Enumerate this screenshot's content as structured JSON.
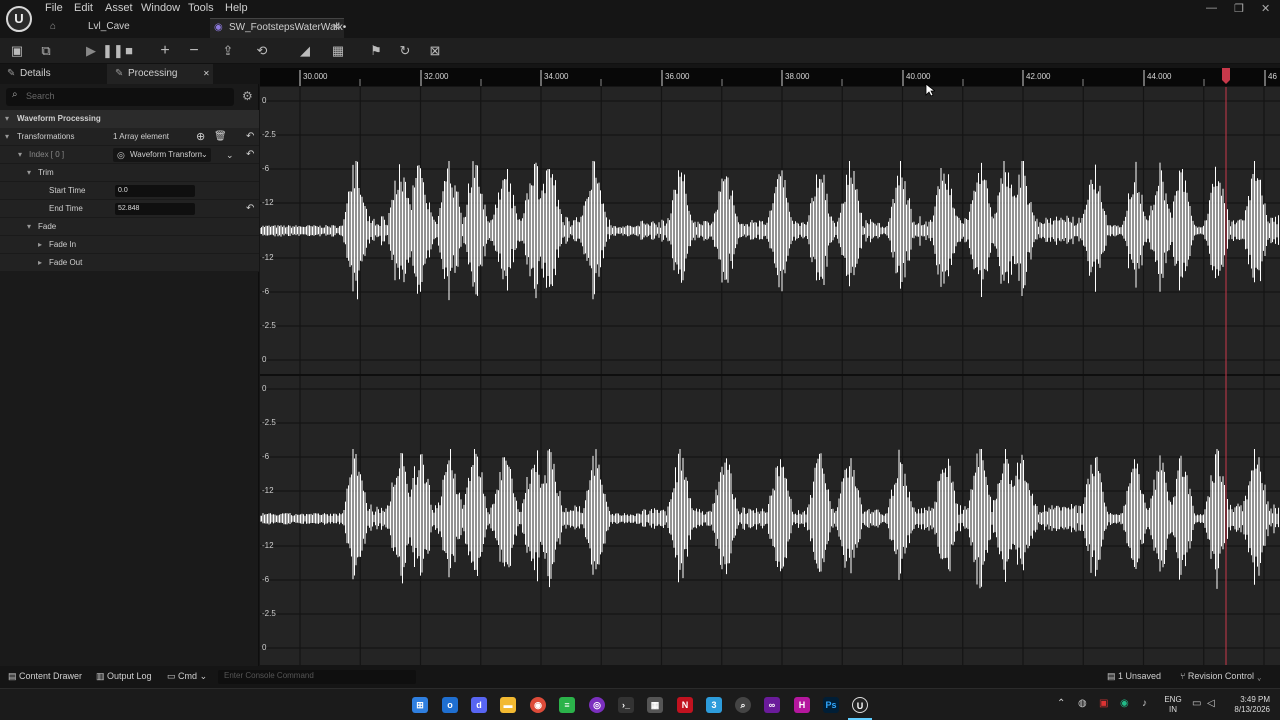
{
  "menu": [
    "File",
    "Edit",
    "Asset",
    "Window",
    "Tools",
    "Help"
  ],
  "tabs": {
    "level": "Lvl_Cave",
    "asset": "SW_FootstepsWaterWalk•"
  },
  "panel": {
    "tab_details": "Details",
    "tab_processing": "Processing",
    "search_placeholder": "Search",
    "section": "Waveform Processing",
    "transformations_label": "Transformations",
    "array_count": "1 Array element",
    "index_label": "Index [ 0 ]",
    "transform_dropdown": "Waveform Transform",
    "trim_label": "Trim",
    "start_time_label": "Start Time",
    "start_time_value": "0.0",
    "end_time_label": "End Time",
    "end_time_value": "52.848",
    "fade_label": "Fade",
    "fade_in_label": "Fade In",
    "fade_out_label": "Fade Out"
  },
  "ruler": [
    "30.000",
    "32.000",
    "34.000",
    "36.000",
    "38.000",
    "40.000",
    "42.000",
    "44.000",
    "46"
  ],
  "amp_labels_top": [
    "0",
    "-2.5",
    "-6",
    "-12",
    "",
    "-12",
    "-6",
    "-2.5",
    "0"
  ],
  "amp_labels_bottom": [
    "0",
    "-2.5",
    "-6",
    "-12",
    "",
    "-12",
    "-6",
    "-2.5",
    "0"
  ],
  "status": {
    "content_drawer": "Content Drawer",
    "output_log": "Output Log",
    "cmd": "Cmd",
    "console_placeholder": "Enter Console Command",
    "unsaved": "1 Unsaved",
    "revision_control": "Revision Control"
  },
  "taskbar": {
    "lang_top": "ENG",
    "lang_bottom": "IN",
    "time": "3:49 PM",
    "date": "8/13/2026"
  },
  "colors": {
    "playhead": "#c8384a",
    "waveform": "#ffffff",
    "accent": "#2f7fe0"
  }
}
